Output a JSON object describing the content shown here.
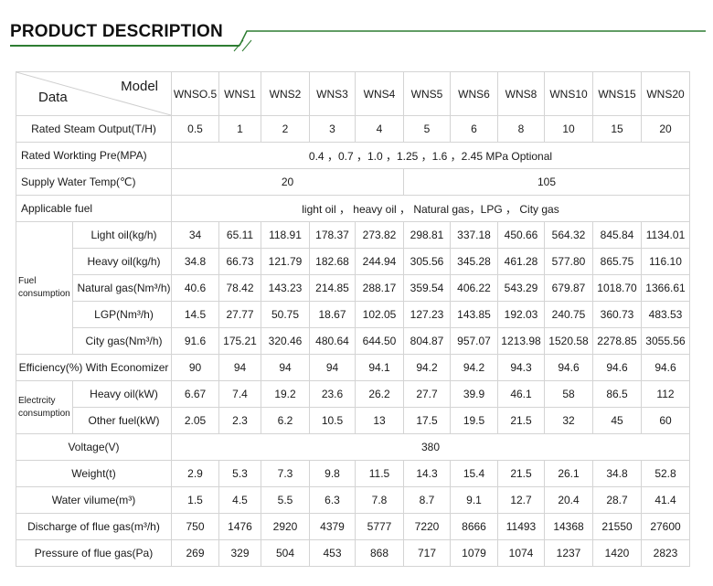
{
  "title": "PRODUCT DESCRIPTION",
  "colors": {
    "accent": "#2e7d32",
    "border": "#d4d4d4",
    "text": "#1a1a1a"
  },
  "table": {
    "corner": {
      "model": "Model",
      "data": "Data"
    },
    "models": [
      "WNSO.5",
      "WNS1",
      "WNS2",
      "WNS3",
      "WNS4",
      "WNS5",
      "WNS6",
      "WNS8",
      "WNS10",
      "WNS15",
      "WNS20"
    ],
    "rated_steam": {
      "label": "Rated Steam Output(T/H)",
      "values": [
        "0.5",
        "1",
        "2",
        "3",
        "4",
        "5",
        "6",
        "8",
        "10",
        "15",
        "20"
      ]
    },
    "rated_pressure": {
      "label": "Rated Workting Pre(MPA)",
      "value": "0.4 ，0.7 ，1.0 ，1.25 ，1.6 ，2.45 MPa   Optional"
    },
    "supply_water": {
      "label": "Supply  Water  Temp(℃)",
      "value_a": "20",
      "value_b": "105"
    },
    "applicable_fuel": {
      "label": "Applicable  fuel",
      "value": "light oil ，  heavy  oil ，  Natural gas，LPG ，  City  gas"
    },
    "fuel_consumption": {
      "group": "Fuel consumption",
      "rows": [
        {
          "label": "Light oil(kg/h)",
          "values": [
            "34",
            "65.11",
            "118.91",
            "178.37",
            "273.82",
            "298.81",
            "337.18",
            "450.66",
            "564.32",
            "845.84",
            "1134.01"
          ]
        },
        {
          "label": "Heavy  oil(kg/h)",
          "values": [
            "34.8",
            "66.73",
            "121.79",
            "182.68",
            "244.94",
            "305.56",
            "345.28",
            "461.28",
            "577.80",
            "865.75",
            "116.10"
          ]
        },
        {
          "label": "Natural gas(Nm³/h)",
          "values": [
            "40.6",
            "78.42",
            "143.23",
            "214.85",
            "288.17",
            "359.54",
            "406.22",
            "543.29",
            "679.87",
            "1018.70",
            "1366.61"
          ]
        },
        {
          "label": "LGP(Nm³/h)",
          "values": [
            "14.5",
            "27.77",
            "50.75",
            "18.67",
            "102.05",
            "127.23",
            "143.85",
            "192.03",
            "240.75",
            "360.73",
            "483.53"
          ]
        },
        {
          "label": "City  gas(Nm³/h)",
          "values": [
            "91.6",
            "175.21",
            "320.46",
            "480.64",
            "644.50",
            "804.87",
            "957.07",
            "1213.98",
            "1520.58",
            "2278.85",
            "3055.56"
          ]
        }
      ]
    },
    "efficiency": {
      "label": "Efficiency(%) With Economizer",
      "values": [
        "90",
        "94",
        "94",
        "94",
        "94.1",
        "94.2",
        "94.2",
        "94.3",
        "94.6",
        "94.6",
        "94.6"
      ]
    },
    "electricity": {
      "group": "Electrcity consumption",
      "rows": [
        {
          "label": "Heavy  oil(kW)",
          "values": [
            "6.67",
            "7.4",
            "19.2",
            "23.6",
            "26.2",
            "27.7",
            "39.9",
            "46.1",
            "58",
            "86.5",
            "112"
          ]
        },
        {
          "label": "Other  fuel(kW)",
          "values": [
            "2.05",
            "2.3",
            "6.2",
            "10.5",
            "13",
            "17.5",
            "19.5",
            "21.5",
            "32",
            "45",
            "60"
          ]
        }
      ]
    },
    "voltage": {
      "label": "Voltage(V)",
      "value": "380"
    },
    "weight": {
      "label": "Weight(t)",
      "values": [
        "2.9",
        "5.3",
        "7.3",
        "9.8",
        "11.5",
        "14.3",
        "15.4",
        "21.5",
        "26.1",
        "34.8",
        "52.8"
      ]
    },
    "water_volume": {
      "label": "Water  vilume(m³)",
      "values": [
        "1.5",
        "4.5",
        "5.5",
        "6.3",
        "7.8",
        "8.7",
        "9.1",
        "12.7",
        "20.4",
        "28.7",
        "41.4"
      ]
    },
    "discharge": {
      "label": "Discharge of flue gas(m³/h)",
      "values": [
        "750",
        "1476",
        "2920",
        "4379",
        "5777",
        "7220",
        "8666",
        "11493",
        "14368",
        "21550",
        "27600"
      ]
    },
    "pressure_flue": {
      "label": "Pressure of  flue  gas(Pa)",
      "values": [
        "269",
        "329",
        "504",
        "453",
        "868",
        "717",
        "1079",
        "1074",
        "1237",
        "1420",
        "2823"
      ]
    }
  }
}
